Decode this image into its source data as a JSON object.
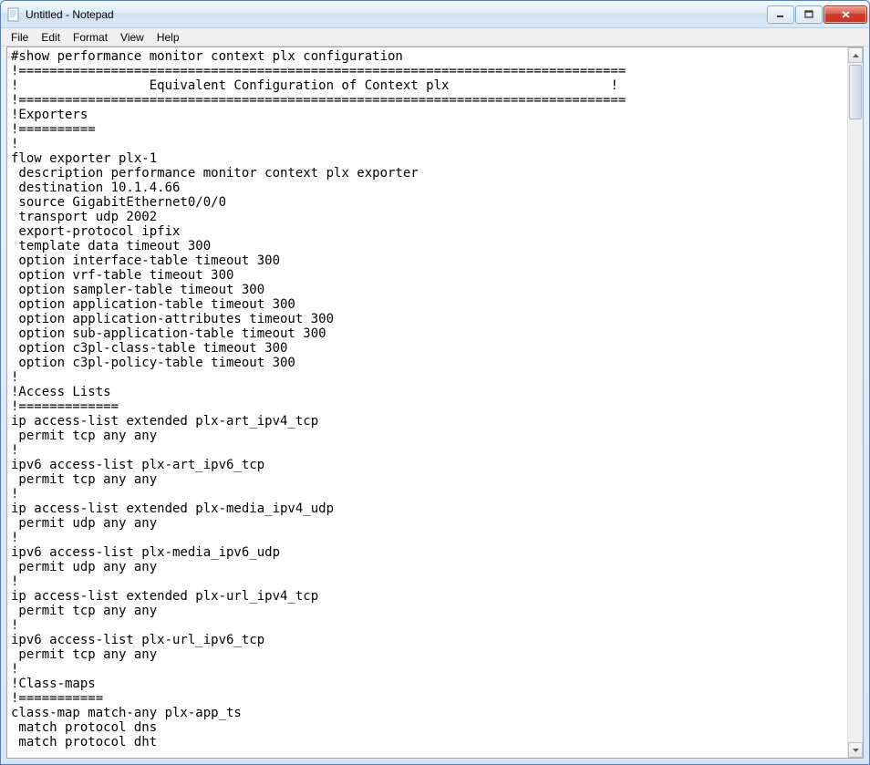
{
  "window": {
    "title": "Untitled - Notepad"
  },
  "menu": {
    "file": "File",
    "edit": "Edit",
    "format": "Format",
    "view": "View",
    "help": "Help"
  },
  "editor": {
    "content": "#show performance monitor context plx configuration\n!===============================================================================\n!                 Equivalent Configuration of Context plx                     !\n!===============================================================================\n!Exporters\n!==========\n!\nflow exporter plx-1\n description performance monitor context plx exporter\n destination 10.1.4.66\n source GigabitEthernet0/0/0\n transport udp 2002\n export-protocol ipfix\n template data timeout 300\n option interface-table timeout 300\n option vrf-table timeout 300\n option sampler-table timeout 300\n option application-table timeout 300\n option application-attributes timeout 300\n option sub-application-table timeout 300\n option c3pl-class-table timeout 300\n option c3pl-policy-table timeout 300\n!\n!Access Lists\n!=============\nip access-list extended plx-art_ipv4_tcp\n permit tcp any any\n!\nipv6 access-list plx-art_ipv6_tcp\n permit tcp any any\n!\nip access-list extended plx-media_ipv4_udp\n permit udp any any\n!\nipv6 access-list plx-media_ipv6_udp\n permit udp any any\n!\nip access-list extended plx-url_ipv4_tcp\n permit tcp any any\n!\nipv6 access-list plx-url_ipv6_tcp\n permit tcp any any\n!\n!Class-maps\n!===========\nclass-map match-any plx-app_ts\n match protocol dns\n match protocol dht"
  }
}
